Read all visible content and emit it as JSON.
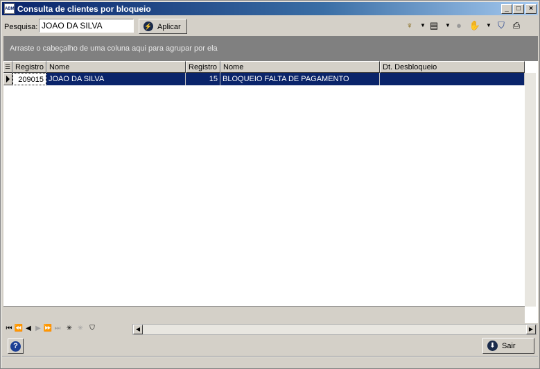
{
  "window": {
    "title": "Consulta de clientes por bloqueio",
    "app_icon_text": "ABM"
  },
  "controls": {
    "minimize": "_",
    "maximize": "□",
    "close": "×"
  },
  "search": {
    "label": "Pesquisa:",
    "value": "JOAO DA SILVA",
    "apply_label": "Aplicar"
  },
  "group_panel": {
    "hint": "Arraste o cabeçalho de uma coluna aqui para agrupar por ela"
  },
  "grid": {
    "columns": [
      "Registro",
      "Nome",
      "Registro",
      "Nome",
      "Dt. Desbloqueio"
    ],
    "rows": [
      {
        "registro": "209015",
        "nome": "JOAO DA SILVA",
        "registro_bloqueio": "15",
        "nome_bloqueio": "BLOQUEIO FALTA DE PAGAMENTO",
        "dt_desbloqueio": ""
      }
    ]
  },
  "footer": {
    "exit_label": "Sair"
  },
  "colors": {
    "title_start": "#0a246a",
    "title_end": "#a6caf0",
    "selection": "#0a246a",
    "group_panel": "#808080"
  },
  "icons": [
    "columns-tree-icon",
    "layout-icon",
    "circle-icon",
    "hand-icon",
    "filter-icon",
    "print-icon",
    "lightning-icon",
    "help-icon",
    "exit-arrow-icon"
  ]
}
